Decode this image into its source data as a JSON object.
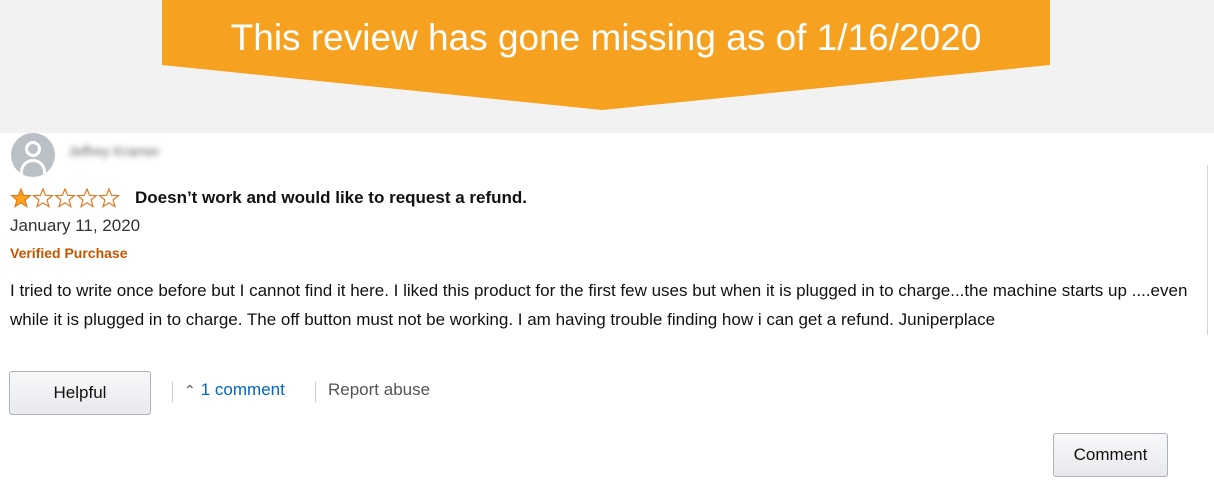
{
  "banner": {
    "text": "This review has gone missing as of 1/16/2020",
    "color": "#f6a120"
  },
  "review": {
    "profile_name": "Jeffrey Kramer",
    "rating": 1,
    "max_rating": 5,
    "star_color": "#ffa41c",
    "title": "Doesn’t work and would like to request a refund.",
    "date": "January 11, 2020",
    "verified_label": "Verified Purchase",
    "body": "I tried to write once before but I cannot find it here. I liked this product for the first few uses but when it is plugged in to charge...the machine starts up ....even while it is plugged in to charge. The off button must not be working. I am having trouble finding how i can get a refund. Juniperplace"
  },
  "actions": {
    "helpful_label": "Helpful",
    "comment_count_label": "1 comment",
    "report_label": "Report abuse",
    "comment_button_label": "Comment"
  }
}
